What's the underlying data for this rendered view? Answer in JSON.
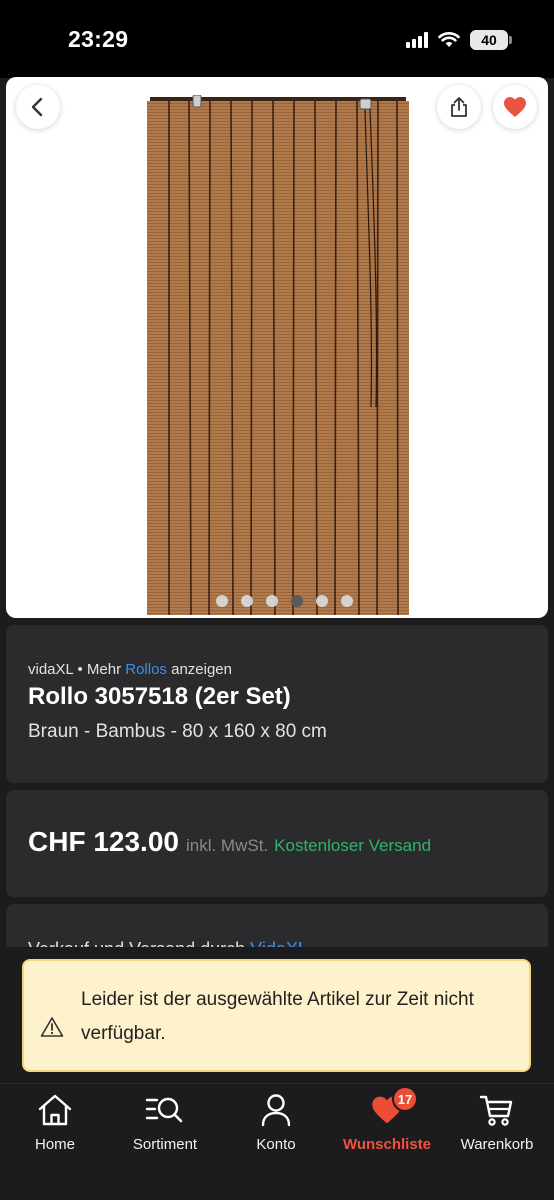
{
  "status_bar": {
    "time": "23:29",
    "battery": "40"
  },
  "product": {
    "brand": "vidaXL",
    "separator": " • Mehr ",
    "category_link": "Rollos",
    "show_more_suffix": " anzeigen",
    "title": "Rollo 3057518 (2er Set)",
    "subtitle": "Braun - Bambus - 80 x 160 x 80 cm",
    "image_dots": 6,
    "active_image_index": 3
  },
  "price": {
    "amount": "CHF 123.00",
    "vat": "inkl. MwSt.",
    "shipping": "Kostenloser Versand"
  },
  "seller": {
    "prefix": "Verkauf und Versand durch ",
    "name": "VidaXL"
  },
  "alert": {
    "icon": "warning-icon",
    "message": "Leider ist der ausgewählte Artikel zur Zeit nicht verfügbar."
  },
  "nav": {
    "items": [
      {
        "label": "Home",
        "icon": "home-icon"
      },
      {
        "label": "Sortiment",
        "icon": "search-list-icon"
      },
      {
        "label": "Konto",
        "icon": "user-icon"
      },
      {
        "label": "Wunschliste",
        "icon": "heart-icon",
        "badge": "17",
        "active": true
      },
      {
        "label": "Warenkorb",
        "icon": "cart-icon"
      }
    ]
  },
  "colors": {
    "background": "#1c1c1e",
    "card": "#2b2b2d",
    "accent": "#f0533a",
    "link": "#3d8fe8",
    "shipping": "#2db46a",
    "alert_bg": "#fdf2cc",
    "alert_border": "#f3d57e"
  }
}
